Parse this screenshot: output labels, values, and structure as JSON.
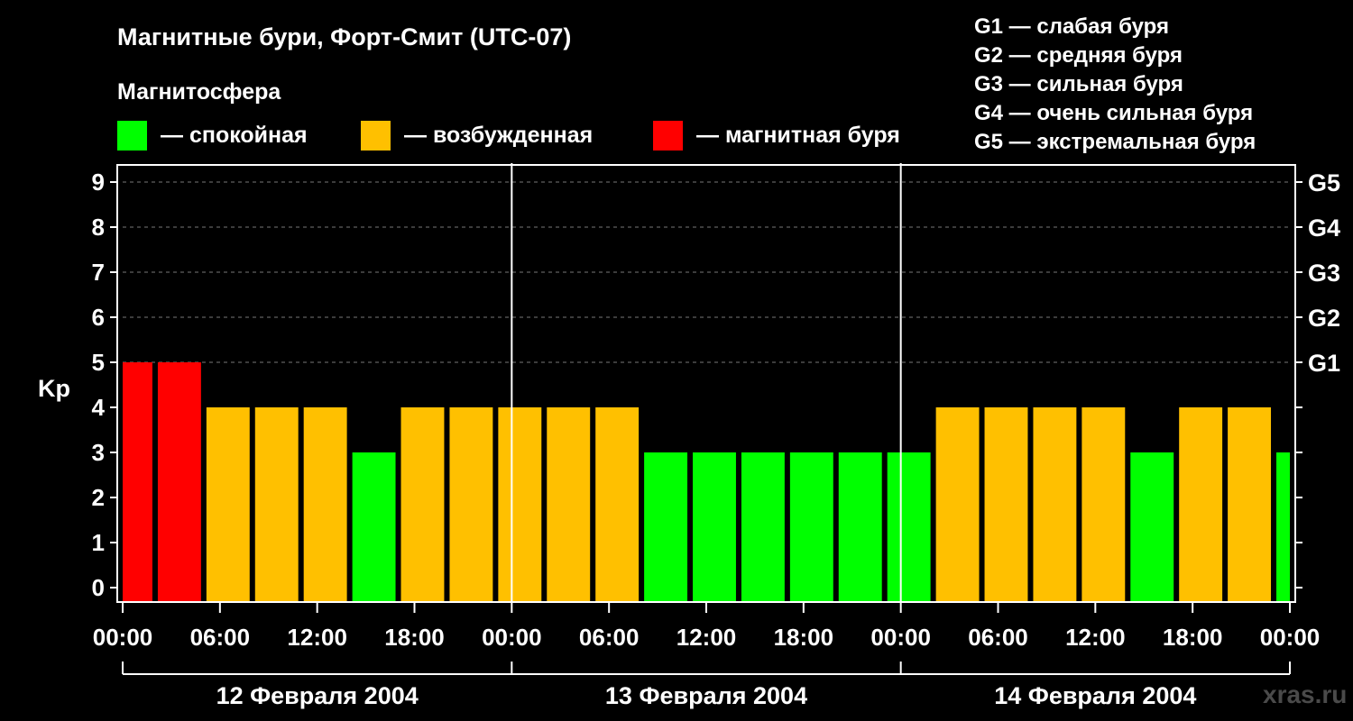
{
  "title": "Магнитные бури, Форт-Смит (UTC-07)",
  "magnetosphere_label": "Магнитосфера",
  "legend": [
    {
      "label": "— спокойная",
      "color": "#00ff00"
    },
    {
      "label": "— возбужденная",
      "color": "#ffc000"
    },
    {
      "label": "— магнитная буря",
      "color": "#ff0000"
    }
  ],
  "g_scale_legend": [
    "G1 — слабая буря",
    "G2 — средняя буря",
    "G3 — сильная буря",
    "G4 — очень сильная буря",
    "G5 — экстремальная буря"
  ],
  "watermark": "xras.ru",
  "chart_data": {
    "type": "bar",
    "ylabel": "Kp",
    "xlabel": "",
    "ylim": [
      0,
      9
    ],
    "y_ticks": [
      "0",
      "1",
      "2",
      "3",
      "4",
      "5",
      "6",
      "7",
      "8",
      "9"
    ],
    "right_ticks": [
      {
        "value": 5,
        "label": "G1"
      },
      {
        "value": 6,
        "label": "G2"
      },
      {
        "value": 7,
        "label": "G3"
      },
      {
        "value": 8,
        "label": "G4"
      },
      {
        "value": 9,
        "label": "G5"
      }
    ],
    "x_tick_labels": [
      "00:00",
      "06:00",
      "12:00",
      "18:00",
      "00:00",
      "06:00",
      "12:00",
      "18:00",
      "00:00",
      "06:00",
      "12:00",
      "18:00",
      "00:00"
    ],
    "x_range_hours": [
      0,
      72
    ],
    "days": [
      "12 Февраля 2004",
      "13 Февраля 2004",
      "14 Февраля 2004"
    ],
    "grid": true,
    "bars": [
      {
        "start": 0,
        "end": 2,
        "value": 5,
        "color": "#ff0000"
      },
      {
        "start": 2,
        "end": 5,
        "value": 5,
        "color": "#ff0000"
      },
      {
        "start": 5,
        "end": 8,
        "value": 4,
        "color": "#ffc000"
      },
      {
        "start": 8,
        "end": 11,
        "value": 4,
        "color": "#ffc000"
      },
      {
        "start": 11,
        "end": 14,
        "value": 4,
        "color": "#ffc000"
      },
      {
        "start": 14,
        "end": 17,
        "value": 3,
        "color": "#00ff00"
      },
      {
        "start": 17,
        "end": 20,
        "value": 4,
        "color": "#ffc000"
      },
      {
        "start": 20,
        "end": 23,
        "value": 4,
        "color": "#ffc000"
      },
      {
        "start": 23,
        "end": 26,
        "value": 4,
        "color": "#ffc000"
      },
      {
        "start": 26,
        "end": 29,
        "value": 4,
        "color": "#ffc000"
      },
      {
        "start": 29,
        "end": 32,
        "value": 4,
        "color": "#ffc000"
      },
      {
        "start": 32,
        "end": 35,
        "value": 3,
        "color": "#00ff00"
      },
      {
        "start": 35,
        "end": 38,
        "value": 3,
        "color": "#00ff00"
      },
      {
        "start": 38,
        "end": 41,
        "value": 3,
        "color": "#00ff00"
      },
      {
        "start": 41,
        "end": 44,
        "value": 3,
        "color": "#00ff00"
      },
      {
        "start": 44,
        "end": 47,
        "value": 3,
        "color": "#00ff00"
      },
      {
        "start": 47,
        "end": 50,
        "value": 3,
        "color": "#00ff00"
      },
      {
        "start": 50,
        "end": 53,
        "value": 4,
        "color": "#ffc000"
      },
      {
        "start": 53,
        "end": 56,
        "value": 4,
        "color": "#ffc000"
      },
      {
        "start": 56,
        "end": 59,
        "value": 4,
        "color": "#ffc000"
      },
      {
        "start": 59,
        "end": 62,
        "value": 4,
        "color": "#ffc000"
      },
      {
        "start": 62,
        "end": 65,
        "value": 3,
        "color": "#00ff00"
      },
      {
        "start": 65,
        "end": 68,
        "value": 4,
        "color": "#ffc000"
      },
      {
        "start": 68,
        "end": 71,
        "value": 4,
        "color": "#ffc000"
      },
      {
        "start": 71,
        "end": 72,
        "value": 3,
        "color": "#00ff00"
      }
    ]
  }
}
